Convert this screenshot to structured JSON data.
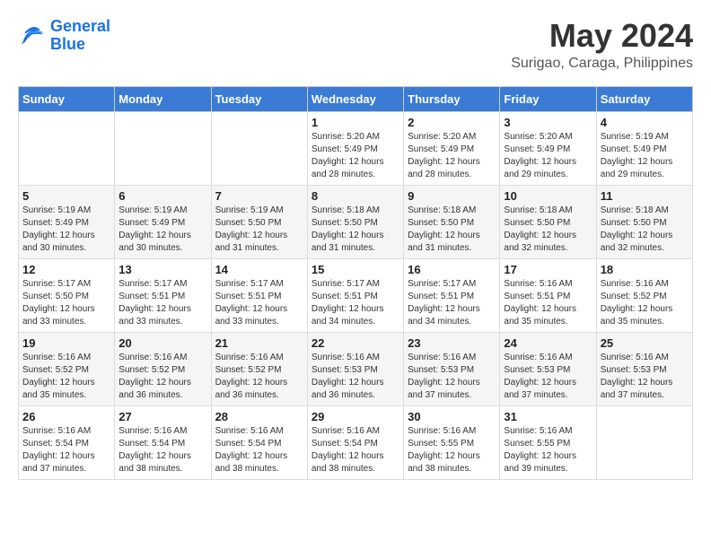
{
  "header": {
    "logo_line1": "General",
    "logo_line2": "Blue",
    "month_year": "May 2024",
    "location": "Surigao, Caraga, Philippines"
  },
  "weekdays": [
    "Sunday",
    "Monday",
    "Tuesday",
    "Wednesday",
    "Thursday",
    "Friday",
    "Saturday"
  ],
  "weeks": [
    [
      {
        "day": "",
        "info": ""
      },
      {
        "day": "",
        "info": ""
      },
      {
        "day": "",
        "info": ""
      },
      {
        "day": "1",
        "info": "Sunrise: 5:20 AM\nSunset: 5:49 PM\nDaylight: 12 hours\nand 28 minutes."
      },
      {
        "day": "2",
        "info": "Sunrise: 5:20 AM\nSunset: 5:49 PM\nDaylight: 12 hours\nand 28 minutes."
      },
      {
        "day": "3",
        "info": "Sunrise: 5:20 AM\nSunset: 5:49 PM\nDaylight: 12 hours\nand 29 minutes."
      },
      {
        "day": "4",
        "info": "Sunrise: 5:19 AM\nSunset: 5:49 PM\nDaylight: 12 hours\nand 29 minutes."
      }
    ],
    [
      {
        "day": "5",
        "info": "Sunrise: 5:19 AM\nSunset: 5:49 PM\nDaylight: 12 hours\nand 30 minutes."
      },
      {
        "day": "6",
        "info": "Sunrise: 5:19 AM\nSunset: 5:49 PM\nDaylight: 12 hours\nand 30 minutes."
      },
      {
        "day": "7",
        "info": "Sunrise: 5:19 AM\nSunset: 5:50 PM\nDaylight: 12 hours\nand 31 minutes."
      },
      {
        "day": "8",
        "info": "Sunrise: 5:18 AM\nSunset: 5:50 PM\nDaylight: 12 hours\nand 31 minutes."
      },
      {
        "day": "9",
        "info": "Sunrise: 5:18 AM\nSunset: 5:50 PM\nDaylight: 12 hours\nand 31 minutes."
      },
      {
        "day": "10",
        "info": "Sunrise: 5:18 AM\nSunset: 5:50 PM\nDaylight: 12 hours\nand 32 minutes."
      },
      {
        "day": "11",
        "info": "Sunrise: 5:18 AM\nSunset: 5:50 PM\nDaylight: 12 hours\nand 32 minutes."
      }
    ],
    [
      {
        "day": "12",
        "info": "Sunrise: 5:17 AM\nSunset: 5:50 PM\nDaylight: 12 hours\nand 33 minutes."
      },
      {
        "day": "13",
        "info": "Sunrise: 5:17 AM\nSunset: 5:51 PM\nDaylight: 12 hours\nand 33 minutes."
      },
      {
        "day": "14",
        "info": "Sunrise: 5:17 AM\nSunset: 5:51 PM\nDaylight: 12 hours\nand 33 minutes."
      },
      {
        "day": "15",
        "info": "Sunrise: 5:17 AM\nSunset: 5:51 PM\nDaylight: 12 hours\nand 34 minutes."
      },
      {
        "day": "16",
        "info": "Sunrise: 5:17 AM\nSunset: 5:51 PM\nDaylight: 12 hours\nand 34 minutes."
      },
      {
        "day": "17",
        "info": "Sunrise: 5:16 AM\nSunset: 5:51 PM\nDaylight: 12 hours\nand 35 minutes."
      },
      {
        "day": "18",
        "info": "Sunrise: 5:16 AM\nSunset: 5:52 PM\nDaylight: 12 hours\nand 35 minutes."
      }
    ],
    [
      {
        "day": "19",
        "info": "Sunrise: 5:16 AM\nSunset: 5:52 PM\nDaylight: 12 hours\nand 35 minutes."
      },
      {
        "day": "20",
        "info": "Sunrise: 5:16 AM\nSunset: 5:52 PM\nDaylight: 12 hours\nand 36 minutes."
      },
      {
        "day": "21",
        "info": "Sunrise: 5:16 AM\nSunset: 5:52 PM\nDaylight: 12 hours\nand 36 minutes."
      },
      {
        "day": "22",
        "info": "Sunrise: 5:16 AM\nSunset: 5:53 PM\nDaylight: 12 hours\nand 36 minutes."
      },
      {
        "day": "23",
        "info": "Sunrise: 5:16 AM\nSunset: 5:53 PM\nDaylight: 12 hours\nand 37 minutes."
      },
      {
        "day": "24",
        "info": "Sunrise: 5:16 AM\nSunset: 5:53 PM\nDaylight: 12 hours\nand 37 minutes."
      },
      {
        "day": "25",
        "info": "Sunrise: 5:16 AM\nSunset: 5:53 PM\nDaylight: 12 hours\nand 37 minutes."
      }
    ],
    [
      {
        "day": "26",
        "info": "Sunrise: 5:16 AM\nSunset: 5:54 PM\nDaylight: 12 hours\nand 37 minutes."
      },
      {
        "day": "27",
        "info": "Sunrise: 5:16 AM\nSunset: 5:54 PM\nDaylight: 12 hours\nand 38 minutes."
      },
      {
        "day": "28",
        "info": "Sunrise: 5:16 AM\nSunset: 5:54 PM\nDaylight: 12 hours\nand 38 minutes."
      },
      {
        "day": "29",
        "info": "Sunrise: 5:16 AM\nSunset: 5:54 PM\nDaylight: 12 hours\nand 38 minutes."
      },
      {
        "day": "30",
        "info": "Sunrise: 5:16 AM\nSunset: 5:55 PM\nDaylight: 12 hours\nand 38 minutes."
      },
      {
        "day": "31",
        "info": "Sunrise: 5:16 AM\nSunset: 5:55 PM\nDaylight: 12 hours\nand 39 minutes."
      },
      {
        "day": "",
        "info": ""
      }
    ]
  ]
}
